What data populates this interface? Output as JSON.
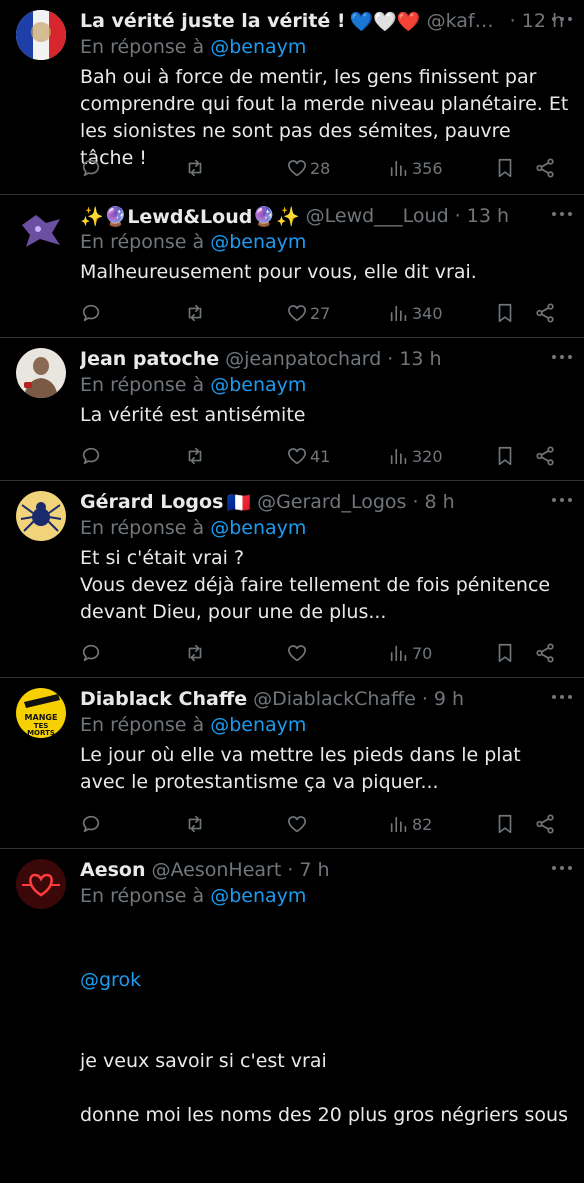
{
  "reply_prefix": "En réponse à",
  "tweets": [
    {
      "name": "La vérité juste la vérité !",
      "emoji": "💙🤍❤️",
      "handle": "@kafka...",
      "time": "· 12 h",
      "reply_to": "@benaym",
      "text": "Bah oui à force de mentir, les gens finissent par comprendre qui fout la merde niveau planétaire. Et les sionistes ne sont pas des sémites, pauvre tâche !",
      "likes": "28",
      "views": "356",
      "avatar_icon": "french-flag-avatar"
    },
    {
      "name": "✨🔮Lewd&Loud🔮✨",
      "emoji": "",
      "handle": "@Lewd___Loud",
      "time": "· 13 h",
      "reply_to": "@benaym",
      "text": "Malheureusement pour vous, elle dit vrai.",
      "likes": "27",
      "views": "340",
      "avatar_icon": "purple-creature-avatar"
    },
    {
      "name": "Jean patoche",
      "emoji": "",
      "handle": "@jeanpatochard",
      "time": "· 13 h",
      "reply_to": "@benaym",
      "text": "La vérité est antisémite",
      "likes": "41",
      "views": "320",
      "avatar_icon": "fighter-avatar"
    },
    {
      "name": "Gérard Logos",
      "emoji": "🇫🇷",
      "handle": "@Gerard_Logos",
      "time": "· 8 h",
      "reply_to": "@benaym",
      "text": "Et si c'était vrai ?\nVous devez déjà faire tellement de fois pénitence devant Dieu, pour une de plus...",
      "likes": "",
      "views": "70",
      "avatar_icon": "spider-avatar"
    },
    {
      "name": "Diablack Chaffe",
      "emoji": "",
      "handle": "@DiablackChaffe",
      "time": "· 9 h",
      "reply_to": "@benaym",
      "text": "Le jour où elle va mettre les pieds dans le plat avec le protestantisme ça va piquer...",
      "likes": "",
      "views": "82",
      "avatar_icon": "mange-tes-morts-avatar",
      "avatar_text": "MANGE TES MORTS"
    },
    {
      "name": "Aeson",
      "emoji": "",
      "handle": "@AesonHeart",
      "time": "· 7 h",
      "reply_to": "@benaym",
      "mention": "@grok",
      "text": "je veux savoir si c'est vrai\n\ndonne moi les noms des 20 plus gros négriers sous",
      "avatar_icon": "neon-heart-avatar"
    }
  ]
}
